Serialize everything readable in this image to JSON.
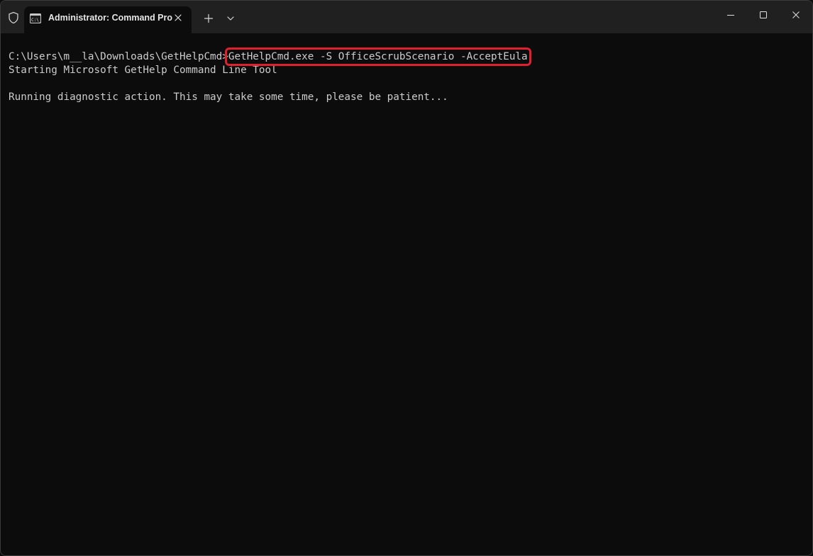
{
  "window": {
    "tab_title": "Administrator: Command Pro"
  },
  "icons": {
    "shield": "shield-icon",
    "tab": "cmd-icon",
    "close_tab": "close-icon",
    "new_tab": "plus-icon",
    "dropdown": "chevron-down-icon",
    "minimize": "minimize-icon",
    "maximize": "maximize-icon",
    "close_window": "close-icon"
  },
  "terminal": {
    "prompt": "C:\\Users\\m__la\\Downloads\\GetHelpCmd>",
    "command": "GetHelpCmd.exe -S OfficeScrubScenario -AcceptEula",
    "line2": "Starting Microsoft GetHelp Command Line Tool",
    "line4": "Running diagnostic action. This may take some time, please be patient..."
  },
  "colors": {
    "background": "#0c0c0c",
    "titlebar": "#202020",
    "text": "#cccccc",
    "highlight": "#e0202e"
  }
}
